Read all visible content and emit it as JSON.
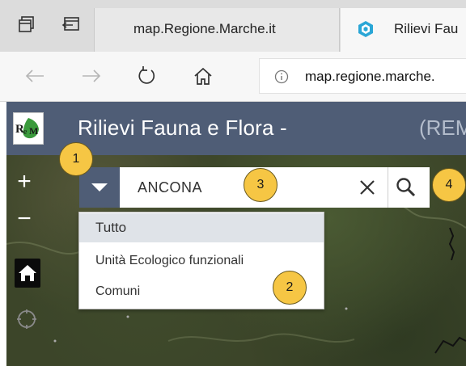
{
  "browser": {
    "tabs": [
      {
        "title": "map.Regione.Marche.it",
        "active": true
      },
      {
        "title": "Rilievi Fau",
        "active": false
      }
    ],
    "address_url": "map.regione.marche."
  },
  "app": {
    "title": "Rilievi Fauna e Flora -",
    "subtitle": "(REM",
    "logo_text": "ReM",
    "header_color": "#4f5d76"
  },
  "map_controls": {
    "zoom_in_label": "+",
    "zoom_out_label": "−"
  },
  "search": {
    "value": "ANCONA",
    "menu": {
      "items": [
        {
          "label": "Tutto",
          "selected": true
        },
        {
          "label": "Unità Ecologico funzionali",
          "selected": false
        },
        {
          "label": "Comuni",
          "selected": false
        }
      ]
    }
  },
  "callouts": [
    "1",
    "2",
    "3",
    "4"
  ],
  "colors": {
    "accent": "#4f5d76",
    "callout_fill": "#f6c644",
    "menu_selected": "#dfe3e8"
  }
}
